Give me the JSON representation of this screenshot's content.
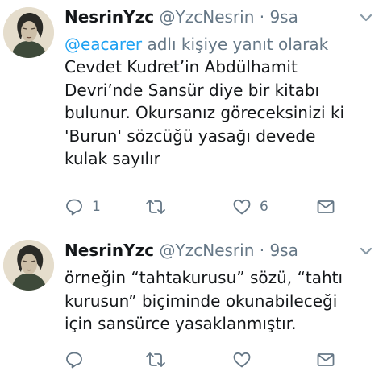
{
  "tweets": [
    {
      "author_name": "NesrinYzc",
      "handle": "@YzcNesrin",
      "separator": "·",
      "time": "9sa",
      "reply_mention": "@eacarer",
      "reply_suffix": " adlı kişiye yanıt olarak",
      "text": "Cevdet Kudret’in Abdülhamit\nDevri’nde Sansür diye bir kitabı\nbulunur. Okursanız göreceksinizi ki\n'Burun' sözcüğü yasağı devede\nkulak sayılır",
      "reply_count": "1",
      "retweet_count": "",
      "like_count": "6"
    },
    {
      "author_name": "NesrinYzc",
      "handle": "@YzcNesrin",
      "separator": "·",
      "time": "9sa",
      "text": "örneğin “tahtakurusu” sözü, “tahtı\nkurusun” biçiminde okunabileceği\niçin sansürce yasaklanmıştır."
    }
  ],
  "icons": {
    "caret": "chevron-down-icon",
    "reply": "reply-icon",
    "retweet": "retweet-icon",
    "like": "heart-icon",
    "dm": "direct-message-icon"
  },
  "colors": {
    "text": "#14171a",
    "secondary": "#657786",
    "link": "#1da1f2"
  }
}
